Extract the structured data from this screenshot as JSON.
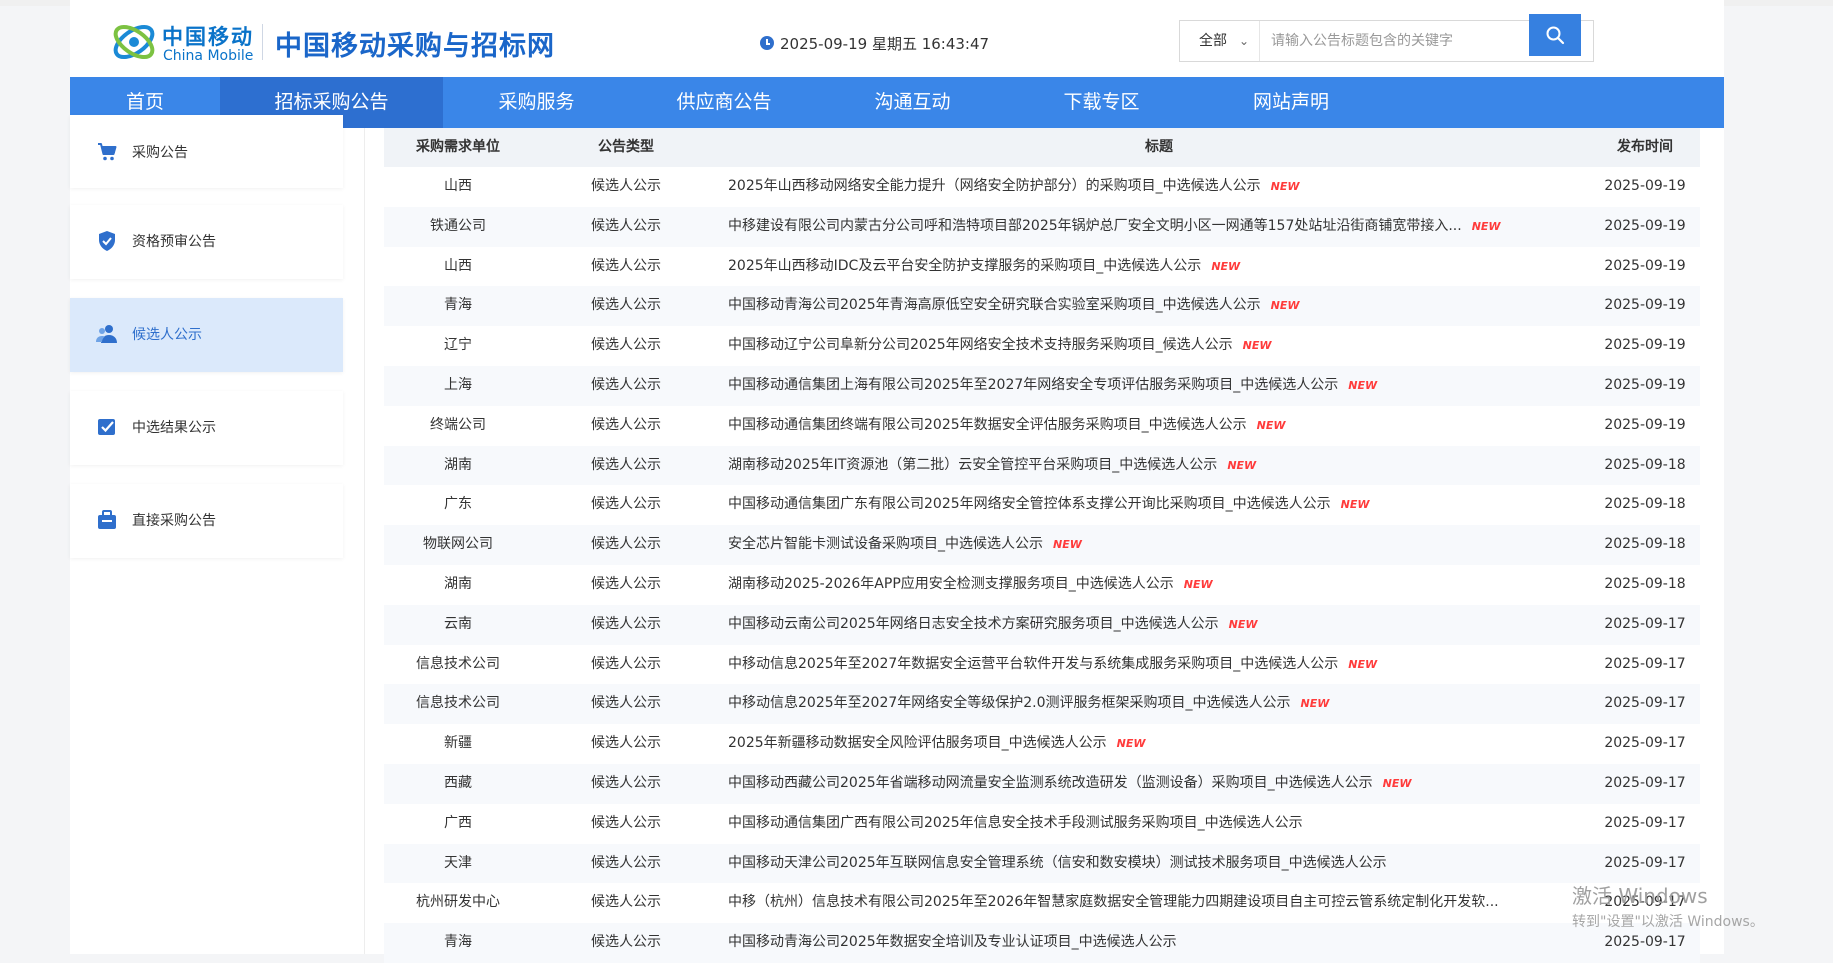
{
  "header": {
    "logo_cn": "中国移动",
    "logo_en": "China Mobile",
    "site_title": "中国移动采购与招标网",
    "datetime": "2025-09-19 星期五 16:43:47",
    "search_scope": "全部",
    "search_placeholder": "请输入公告标题包含的关键字"
  },
  "nav": {
    "items": [
      {
        "label": "首页"
      },
      {
        "label": "招标采购公告"
      },
      {
        "label": "采购服务"
      },
      {
        "label": "供应商公告"
      },
      {
        "label": "沟通互动"
      },
      {
        "label": "下载专区"
      },
      {
        "label": "网站声明"
      }
    ],
    "active_index": 1
  },
  "sidebar": {
    "items": [
      {
        "label": "采购公告",
        "icon": "cart-icon"
      },
      {
        "label": "资格预审公告",
        "icon": "shield-icon"
      },
      {
        "label": "候选人公示",
        "icon": "users-icon"
      },
      {
        "label": "中选结果公示",
        "icon": "checkbox-icon"
      },
      {
        "label": "直接采购公告",
        "icon": "briefcase-icon"
      }
    ],
    "active_index": 2
  },
  "table": {
    "headers": {
      "unit": "采购需求单位",
      "type": "公告类型",
      "title": "标题",
      "date": "发布时间"
    },
    "new_label": "NEW",
    "rows": [
      {
        "unit": "山西",
        "type": "候选人公示",
        "title": "2025年山西移动网络安全能力提升（网络安全防护部分）的采购项目_中选候选人公示",
        "date": "2025-09-19",
        "is_new": true
      },
      {
        "unit": "铁通公司",
        "type": "候选人公示",
        "title": "中移建设有限公司内蒙古分公司呼和浩特项目部2025年锅炉总厂安全文明小区一网通等157处站址沿街商铺宽带接入...",
        "date": "2025-09-19",
        "is_new": true
      },
      {
        "unit": "山西",
        "type": "候选人公示",
        "title": "2025年山西移动IDC及云平台安全防护支撑服务的采购项目_中选候选人公示",
        "date": "2025-09-19",
        "is_new": true
      },
      {
        "unit": "青海",
        "type": "候选人公示",
        "title": "中国移动青海公司2025年青海高原低空安全研究联合实验室采购项目_中选候选人公示",
        "date": "2025-09-19",
        "is_new": true
      },
      {
        "unit": "辽宁",
        "type": "候选人公示",
        "title": "中国移动辽宁公司阜新分公司2025年网络安全技术支持服务采购项目_候选人公示",
        "date": "2025-09-19",
        "is_new": true
      },
      {
        "unit": "上海",
        "type": "候选人公示",
        "title": "中国移动通信集团上海有限公司2025年至2027年网络安全专项评估服务采购项目_中选候选人公示",
        "date": "2025-09-19",
        "is_new": true
      },
      {
        "unit": "终端公司",
        "type": "候选人公示",
        "title": "中国移动通信集团终端有限公司2025年数据安全评估服务采购项目_中选候选人公示",
        "date": "2025-09-19",
        "is_new": true
      },
      {
        "unit": "湖南",
        "type": "候选人公示",
        "title": "湖南移动2025年IT资源池（第二批）云安全管控平台采购项目_中选候选人公示",
        "date": "2025-09-18",
        "is_new": true
      },
      {
        "unit": "广东",
        "type": "候选人公示",
        "title": "中国移动通信集团广东有限公司2025年网络安全管控体系支撑公开询比采购项目_中选候选人公示",
        "date": "2025-09-18",
        "is_new": true
      },
      {
        "unit": "物联网公司",
        "type": "候选人公示",
        "title": "安全芯片智能卡测试设备采购项目_中选候选人公示",
        "date": "2025-09-18",
        "is_new": true
      },
      {
        "unit": "湖南",
        "type": "候选人公示",
        "title": "湖南移动2025-2026年APP应用安全检测支撑服务项目_中选候选人公示",
        "date": "2025-09-18",
        "is_new": true
      },
      {
        "unit": "云南",
        "type": "候选人公示",
        "title": "中国移动云南公司2025年网络日志安全技术方案研究服务项目_中选候选人公示",
        "date": "2025-09-17",
        "is_new": true
      },
      {
        "unit": "信息技术公司",
        "type": "候选人公示",
        "title": "中移动信息2025年至2027年数据安全运营平台软件开发与系统集成服务采购项目_中选候选人公示",
        "date": "2025-09-17",
        "is_new": true
      },
      {
        "unit": "信息技术公司",
        "type": "候选人公示",
        "title": "中移动信息2025年至2027年网络安全等级保护2.0测评服务框架采购项目_中选候选人公示",
        "date": "2025-09-17",
        "is_new": true
      },
      {
        "unit": "新疆",
        "type": "候选人公示",
        "title": "2025年新疆移动数据安全风险评估服务项目_中选候选人公示",
        "date": "2025-09-17",
        "is_new": true
      },
      {
        "unit": "西藏",
        "type": "候选人公示",
        "title": "中国移动西藏公司2025年省端移动网流量安全监测系统改造研发（监测设备）采购项目_中选候选人公示",
        "date": "2025-09-17",
        "is_new": true
      },
      {
        "unit": "广西",
        "type": "候选人公示",
        "title": "中国移动通信集团广西有限公司2025年信息安全技术手段测试服务采购项目_中选候选人公示",
        "date": "2025-09-17",
        "is_new": false
      },
      {
        "unit": "天津",
        "type": "候选人公示",
        "title": "中国移动天津公司2025年互联网信息安全管理系统（信安和数安模块）测试技术服务项目_中选候选人公示",
        "date": "2025-09-17",
        "is_new": false
      },
      {
        "unit": "杭州研发中心",
        "type": "候选人公示",
        "title": "中移（杭州）信息技术有限公司2025年至2026年智慧家庭数据安全管理能力四期建设项目自主可控云管系统定制化开发软...",
        "date": "2025-09-17",
        "is_new": false
      },
      {
        "unit": "青海",
        "type": "候选人公示",
        "title": "中国移动青海公司2025年数据安全培训及专业认证项目_中选候选人公示",
        "date": "2025-09-17",
        "is_new": false
      }
    ]
  },
  "watermark": {
    "line1": "激活 Windows",
    "line2": "转到\"设置\"以激活 Windows。"
  }
}
